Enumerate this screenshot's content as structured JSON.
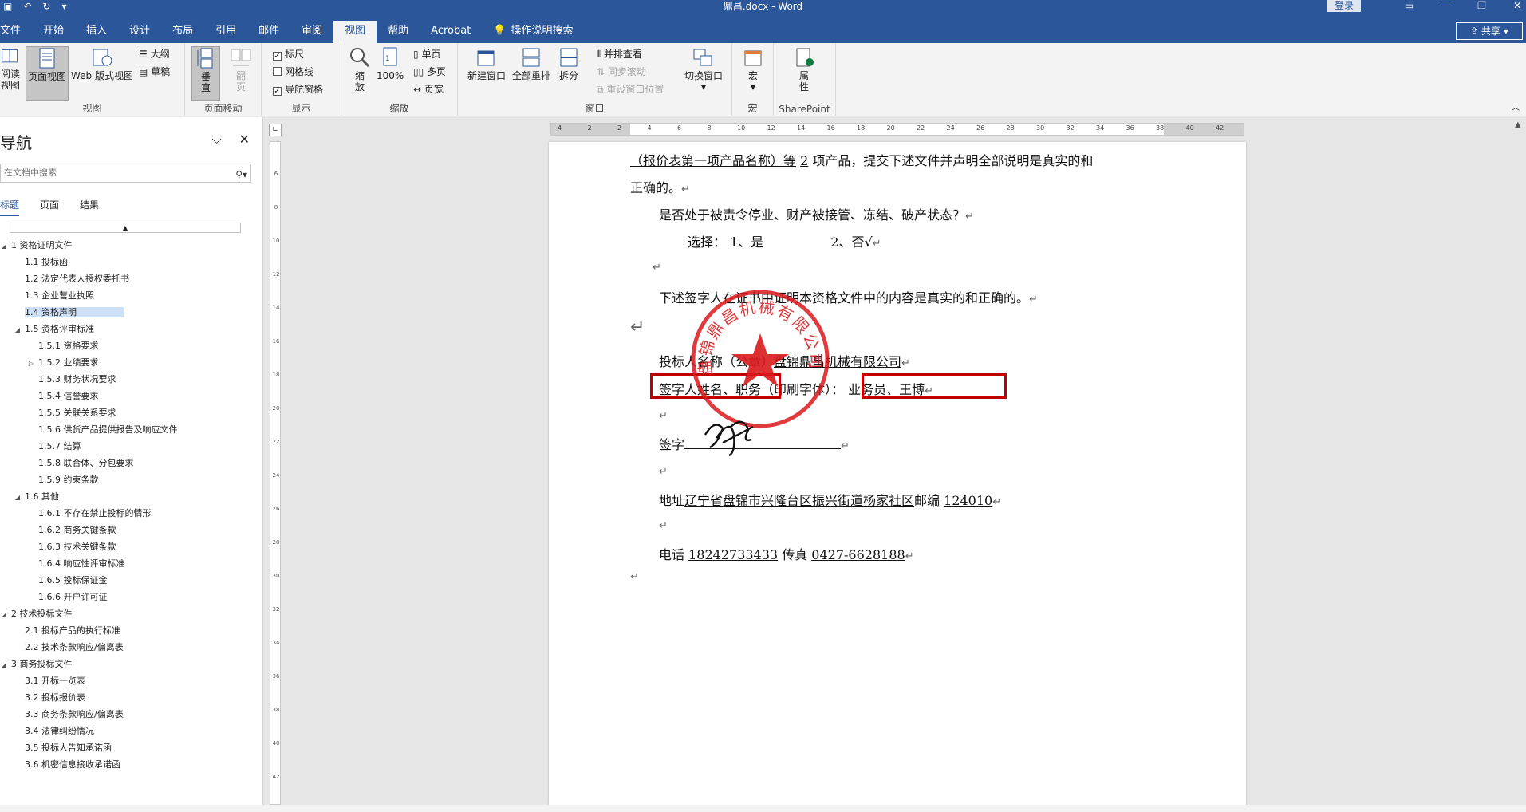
{
  "window": {
    "title": "鼎昌.docx - Word",
    "login_label": "登录",
    "share_label": "共享",
    "qat_icons": [
      "save-icon",
      "undo-icon",
      "redo-icon",
      "customize-icon"
    ],
    "window_controls": [
      "ribbon-display-icon",
      "minimize-icon",
      "restore-icon",
      "close-icon"
    ]
  },
  "tabs": [
    {
      "label": "文件"
    },
    {
      "label": "开始"
    },
    {
      "label": "插入"
    },
    {
      "label": "设计"
    },
    {
      "label": "布局"
    },
    {
      "label": "引用"
    },
    {
      "label": "邮件"
    },
    {
      "label": "审阅"
    },
    {
      "label": "视图",
      "active": true
    },
    {
      "label": "帮助"
    },
    {
      "label": "Acrobat"
    },
    {
      "label": "操作说明搜索"
    }
  ],
  "ribbon": {
    "views": {
      "label": "视图",
      "read_mode": "阅读\n视图",
      "print_layout": "页面视图",
      "web_layout": "Web 版式视图",
      "outline": "大纲",
      "draft": "草稿"
    },
    "page_movement": {
      "label": "页面移动",
      "vertical": "垂\n直",
      "side_to_side": "翻\n页"
    },
    "show": {
      "label": "显示",
      "ruler": "标尺",
      "gridlines": "网格线",
      "nav_pane": "导航窗格",
      "ruler_checked": true,
      "gridlines_checked": false,
      "nav_pane_checked": true
    },
    "zoom": {
      "label": "缩放",
      "zoom": "缩\n放",
      "hundred": "100%",
      "one_page": "单页",
      "multiple_pages": "多页",
      "page_width": "页宽"
    },
    "window": {
      "label": "窗口",
      "new_window": "新建窗口",
      "arrange_all": "全部重排",
      "split": "拆分",
      "side_by_side": "并排查看",
      "sync_scroll": "同步滚动",
      "reset_position": "重设窗口位置",
      "switch_windows": "切换窗口"
    },
    "macros": {
      "label": "宏",
      "macros": "宏"
    },
    "sharepoint": {
      "label": "SharePoint",
      "properties": "属\n性"
    }
  },
  "nav": {
    "title": "导航",
    "search_placeholder": "在文档中搜索",
    "tabs": [
      "标题",
      "页面",
      "结果"
    ],
    "items": [
      {
        "label": "1 资格证明文件",
        "level": 0,
        "expanded": true
      },
      {
        "label": "1.1 投标函",
        "level": 1
      },
      {
        "label": "1.2 法定代表人授权委托书",
        "level": 1
      },
      {
        "label": "1.3 企业营业执照",
        "level": 1
      },
      {
        "label": "1.4 资格声明",
        "level": 1,
        "selected": true
      },
      {
        "label": "1.5 资格评审标准",
        "level": 1,
        "expanded": true
      },
      {
        "label": "1.5.1 资格要求",
        "level": 2
      },
      {
        "label": "1.5.2 业绩要求",
        "level": 2,
        "collapsed": true
      },
      {
        "label": "1.5.3 财务状况要求",
        "level": 2
      },
      {
        "label": "1.5.4 信誉要求",
        "level": 2
      },
      {
        "label": "1.5.5 关联关系要求",
        "level": 2
      },
      {
        "label": "1.5.6 供货产品提供报告及响应文件",
        "level": 2
      },
      {
        "label": "1.5.7 结算",
        "level": 2
      },
      {
        "label": "1.5.8 联合体、分包要求",
        "level": 2
      },
      {
        "label": "1.5.9 约束条款",
        "level": 2
      },
      {
        "label": "1.6 其他",
        "level": 1,
        "expanded": true
      },
      {
        "label": "1.6.1 不存在禁止投标的情形",
        "level": 2
      },
      {
        "label": "1.6.2 商务关键条款",
        "level": 2
      },
      {
        "label": "1.6.3 技术关键条款",
        "level": 2
      },
      {
        "label": "1.6.4 响应性评审标准",
        "level": 2
      },
      {
        "label": "1.6.5 投标保证金",
        "level": 2
      },
      {
        "label": "1.6.6 开户许可证",
        "level": 2
      },
      {
        "label": "2 技术投标文件",
        "level": 0,
        "expanded": true
      },
      {
        "label": "2.1 投标产品的执行标准",
        "level": 1
      },
      {
        "label": "2.2 技术条款响应/偏离表",
        "level": 1
      },
      {
        "label": "3 商务投标文件",
        "level": 0,
        "expanded": true
      },
      {
        "label": "3.1 开标一览表",
        "level": 1
      },
      {
        "label": "3.2 投标报价表",
        "level": 1
      },
      {
        "label": "3.3 商务条款响应/偏离表",
        "level": 1
      },
      {
        "label": "3.4 法律纠纷情况",
        "level": 1
      },
      {
        "label": "3.5 投标人告知承诺函",
        "level": 1
      },
      {
        "label": "3.6 机密信息接收承诺函",
        "level": 1
      }
    ]
  },
  "ruler": {
    "h_ticks": [
      "4",
      "2",
      "2",
      "4",
      "6",
      "8",
      "10",
      "12",
      "14",
      "16",
      "18",
      "20",
      "22",
      "24",
      "26",
      "28",
      "30",
      "32",
      "34",
      "36",
      "38",
      "40",
      "42"
    ],
    "v_ticks": [
      "6",
      "8",
      "10",
      "12",
      "14",
      "16",
      "18",
      "20",
      "22",
      "24",
      "26",
      "28",
      "30",
      "32",
      "34",
      "36",
      "38",
      "40",
      "42"
    ]
  },
  "document": {
    "line1_a": "（报价表第一项产品名称）等",
    "line1_num": "2",
    "line1_b": "项产品，提交下述文件并声明全部说明是真实的和",
    "line2": "正确的。",
    "q1": "是否处于被责令停业、财产被接管、冻结、破产状态？",
    "choice_a": "选择：  1、是",
    "choice_b": "2、否√",
    "declare": "下述签字人在证书中证明本资格文件中的内容是真实的和正确的。",
    "bidder_label": "投标人名称（公章）",
    "bidder_name": "盘锦鼎昌机械有限公司",
    "signer_label": "签字人姓名、职务",
    "print_label": "（印刷字体）：",
    "signer_value": "业务员、王博",
    "sign_label": "签字",
    "address_label": "地址",
    "address_value": "辽宁省盘锦市兴隆台区振兴街道杨家社区",
    "zip_label": "邮编",
    "zip_value": "124010",
    "phone_label": "电话",
    "phone_value": "18242733433",
    "fax_label": "传真",
    "fax_value": "0427-6628188",
    "para_mark": "↵",
    "seal_text": "盘锦鼎昌机械有限公司"
  },
  "colors": {
    "word_blue": "#2b579a",
    "highlight_box": "#c00000",
    "seal_red": "#d9191c",
    "nav_selected": "#cce0f7"
  }
}
